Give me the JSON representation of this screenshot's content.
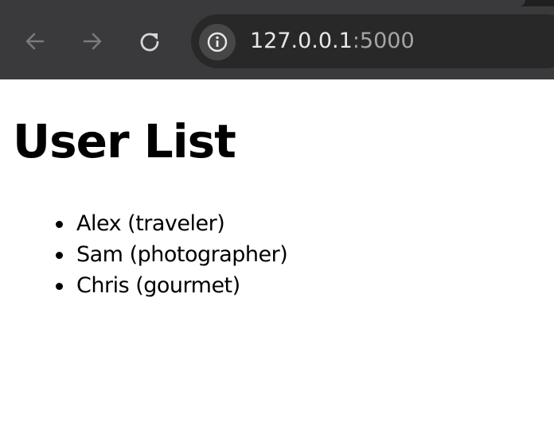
{
  "browser": {
    "url_host": "127.0.0.1",
    "url_port": ":5000",
    "icons": {
      "back": "arrow-left-icon",
      "forward": "arrow-right-icon",
      "reload": "reload-icon",
      "site_info": "info-icon"
    }
  },
  "page": {
    "title": "User List",
    "users": [
      {
        "label": "Alex (traveler)"
      },
      {
        "label": "Sam (photographer)"
      },
      {
        "label": "Chris (gourmet)"
      }
    ]
  },
  "colors": {
    "chrome_bg": "#3a3a3c",
    "omnibox_bg": "#282828",
    "page_bg": "#ffffff",
    "text": "#000000"
  }
}
